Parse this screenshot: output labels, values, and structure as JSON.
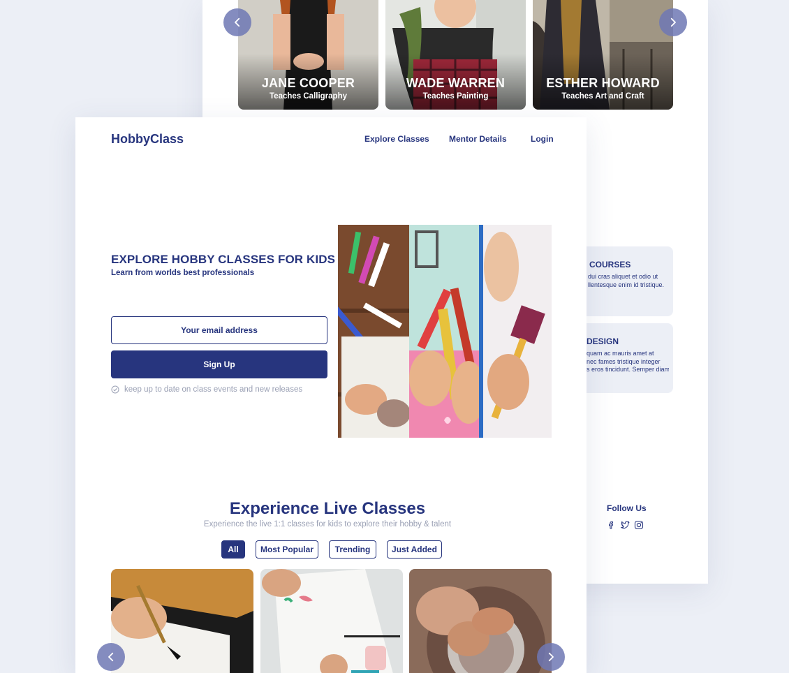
{
  "mentors": [
    {
      "name": "JANE COOPER",
      "subtitle": "Teaches Calligraphy"
    },
    {
      "name": "WADE WARREN",
      "subtitle": "Teaches Painting"
    },
    {
      "name": "ESTHER HOWARD",
      "subtitle": "Teaches Art and Craft"
    }
  ],
  "side_cards": [
    {
      "title": "COURSES",
      "lines": [
        "dui cras aliquet et odio ut",
        "llentesque enim id tristique."
      ]
    },
    {
      "title": "DESIGN",
      "lines": [
        "quam ac mauris amet at",
        "nec fames tristique integer",
        "s eros tincidunt. Semper diam"
      ]
    }
  ],
  "footer": {
    "follow_label": "Follow Us",
    "social_icons": [
      "facebook-icon",
      "twitter-icon",
      "instagram-icon"
    ]
  },
  "header": {
    "logo": "HobbyClass",
    "nav": [
      "Explore Classes",
      "Mentor Details",
      "Login"
    ]
  },
  "hero": {
    "title": "EXPLORE HOBBY CLASSES FOR KIDS",
    "subtitle": "Learn from worlds best professionals",
    "email_placeholder": "Your email address",
    "signup_label": "Sign Up",
    "note": "keep up to date on class events and new releases"
  },
  "live": {
    "title": "Experience Live Classes",
    "subtitle": "Experience the live 1:1 classes for kids to explore their hobby & talent",
    "filters": [
      "All",
      "Most Popular",
      "Trending",
      "Just Added"
    ],
    "active_filter": "All"
  },
  "colors": {
    "primary": "#27357e",
    "muted": "#9aa0b4",
    "background": "#eceff6"
  }
}
